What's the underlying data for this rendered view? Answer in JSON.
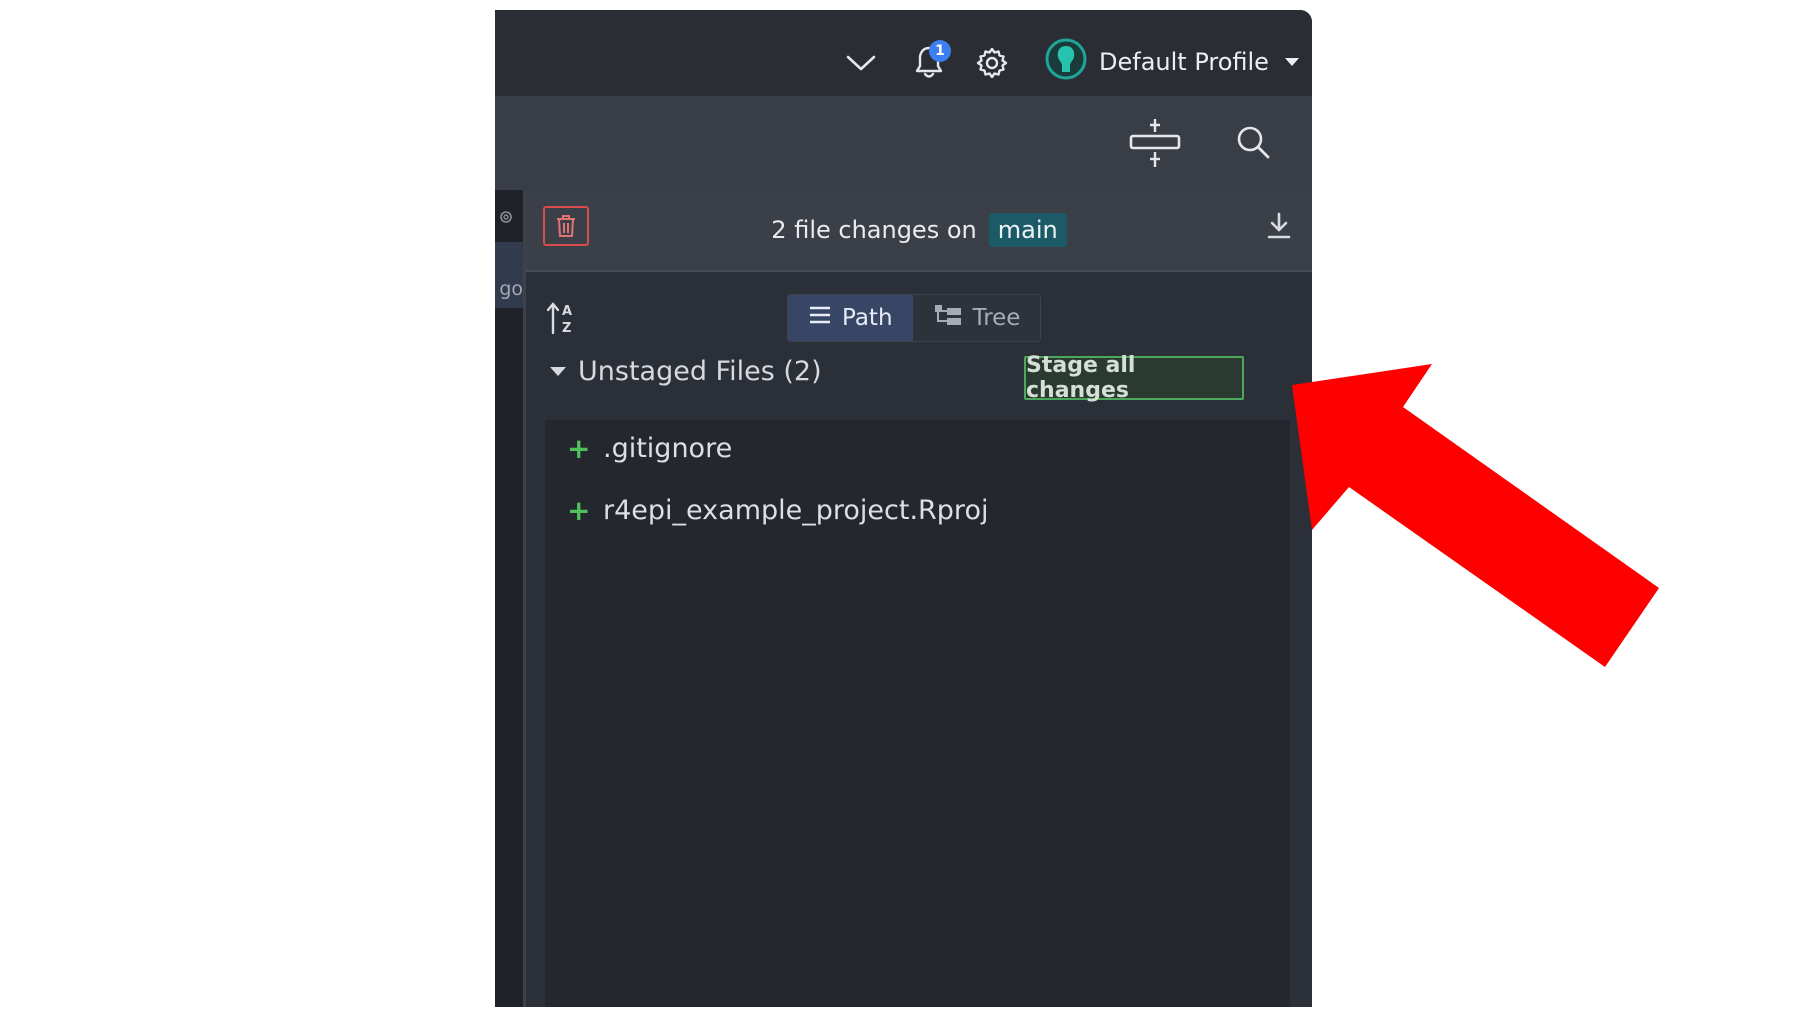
{
  "topbar": {
    "chevron_icon": "chevron-down-icon",
    "notification_count": "1",
    "profile_name": "Default Profile"
  },
  "sidebar": {
    "partial_label": "go"
  },
  "panel": {
    "header_text": "2 file changes on",
    "branch": "main",
    "view_tabs": [
      {
        "label": "Path",
        "active": true
      },
      {
        "label": "Tree",
        "active": false
      }
    ],
    "section_title": "Unstaged Files (2)",
    "stage_all_label": "Stage all changes",
    "files": [
      {
        "name": ".gitignore",
        "status": "+"
      },
      {
        "name": "r4epi_example_project.Rproj",
        "status": "+"
      }
    ]
  },
  "colors": {
    "accent_red": "#ff0000",
    "stage_green": "#4ca85c",
    "branch_teal": "#1d5a67",
    "notify_blue": "#3d7ef0"
  }
}
